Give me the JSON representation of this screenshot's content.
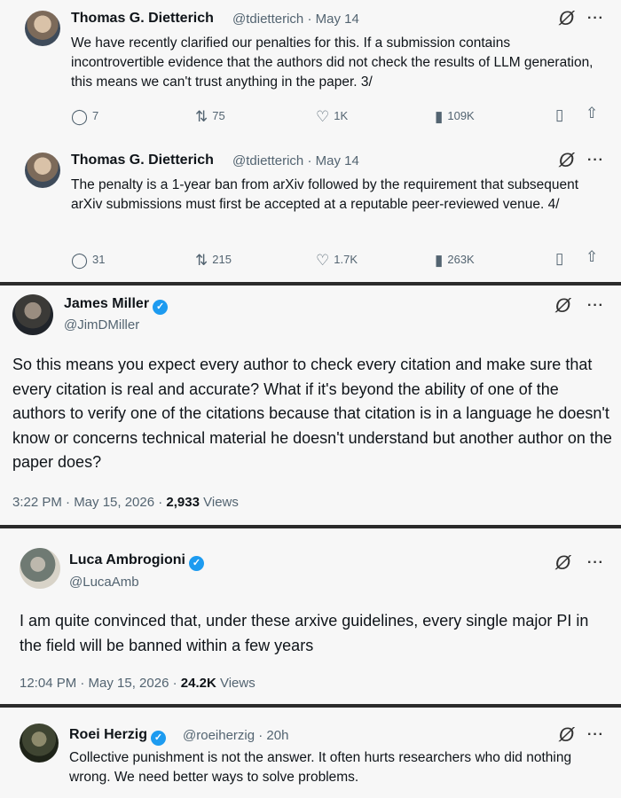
{
  "tweets": [
    {
      "name": "Thomas G. Dietterich",
      "handle": "@tdietterich",
      "date": "· May 14",
      "text": "We have recently clarified our penalties for this. If a submission contains incontrovertible evidence that the authors did not check the results of LLM generation, this means we can't trust anything in the paper. 3/",
      "replies": "7",
      "reposts": "75",
      "likes": "1K",
      "views": "109K"
    },
    {
      "name": "Thomas G. Dietterich",
      "handle": "@tdietterich",
      "date": "· May 14",
      "text": "The penalty is a 1-year ban from arXiv followed by the requirement that subsequent arXiv submissions must first be accepted at a reputable peer-reviewed venue. 4/",
      "replies": "31",
      "reposts": "215",
      "likes": "1.7K",
      "views": "263K"
    },
    {
      "name": "James Miller",
      "handle": "@JimDMiller",
      "text": "So this means you expect every author to check every citation and make sure that every citation is real and accurate? What if it's beyond the ability of one of the authors to verify one of the citations because that citation is in a language he doesn't know or concerns technical material he doesn't understand but another author on the paper does?",
      "time": "3:22 PM · May 15, 2026 · ",
      "views_count": "2,933",
      "views_label": " Views"
    },
    {
      "name": "Luca Ambrogioni",
      "handle": "@LucaAmb",
      "text": "I am quite convinced that, under these arxive guidelines, every single major PI in the field will be banned within a few years",
      "time": "12:04 PM · May 15, 2026 · ",
      "views_count": "24.2K",
      "views_label": " Views"
    },
    {
      "name": "Roei Herzig",
      "handle": "@roeiherzig",
      "date": "· 20h",
      "text": "Collective punishment is not the answer. It often hurts researchers who did nothing wrong. We need better ways to solve problems."
    }
  ],
  "icons": {
    "reply": "speech-bubble-icon",
    "repost": "repost-arrows-icon",
    "like": "heart-icon",
    "views": "bar-chart-icon",
    "bookmark": "bookmark-icon",
    "share": "share-icon",
    "grok": "grok-slash-icon",
    "more": "more-dots-icon",
    "verified": "verified-badge-icon"
  },
  "colors": {
    "verified": "#1d9bf0",
    "secondary": "#536471"
  }
}
